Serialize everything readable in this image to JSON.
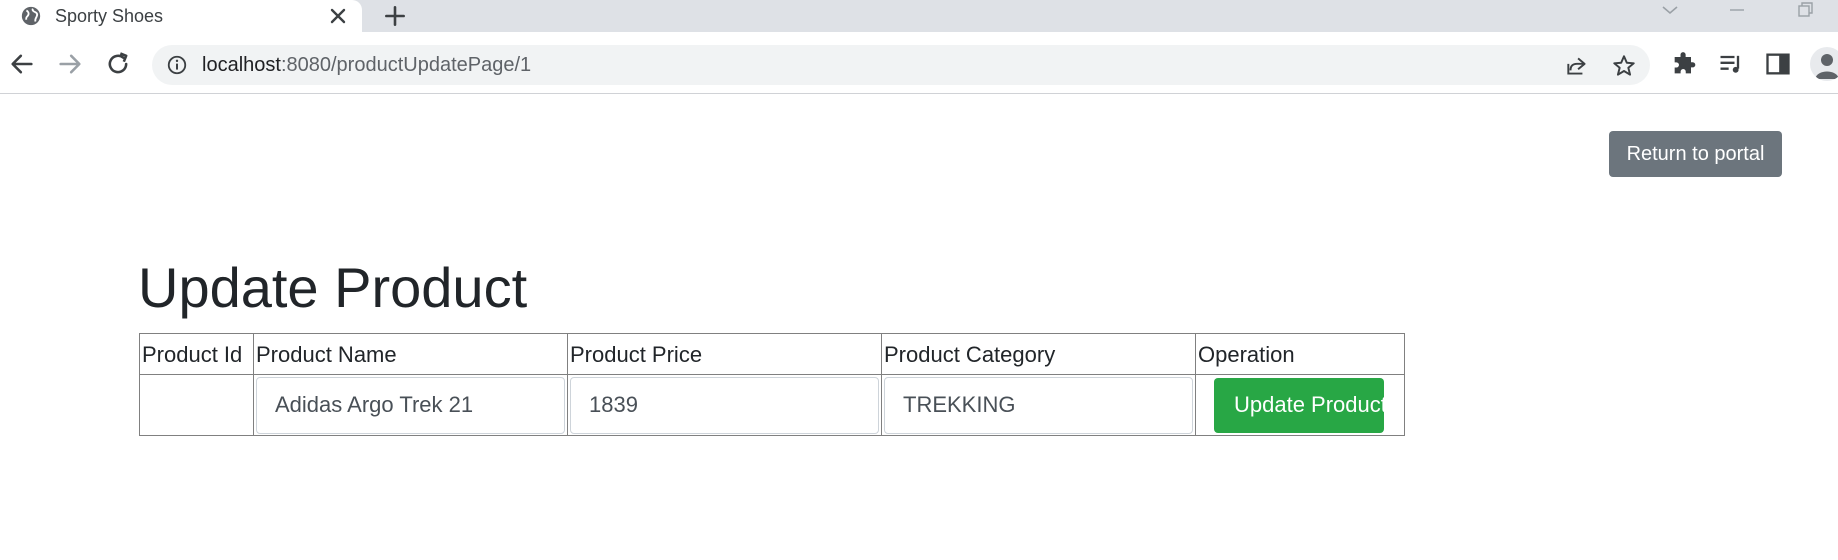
{
  "browser": {
    "tab_title": "Sporty Shoes",
    "url_host": "localhost",
    "url_rest": ":8080/productUpdatePage/1"
  },
  "page": {
    "return_button_label": "Return to portal",
    "title": "Update Product",
    "table": {
      "headers": [
        "Product Id",
        "Product Name",
        "Product Price",
        "Product Category",
        "Operation"
      ],
      "row": {
        "product_id": "",
        "product_name": "Adidas Argo Trek 21",
        "product_price": "1839",
        "product_category": "TREKKING",
        "operation_label": "Update Product"
      }
    }
  },
  "colors": {
    "return_button_bg": "#6c757d",
    "update_button_bg": "#28a745"
  }
}
